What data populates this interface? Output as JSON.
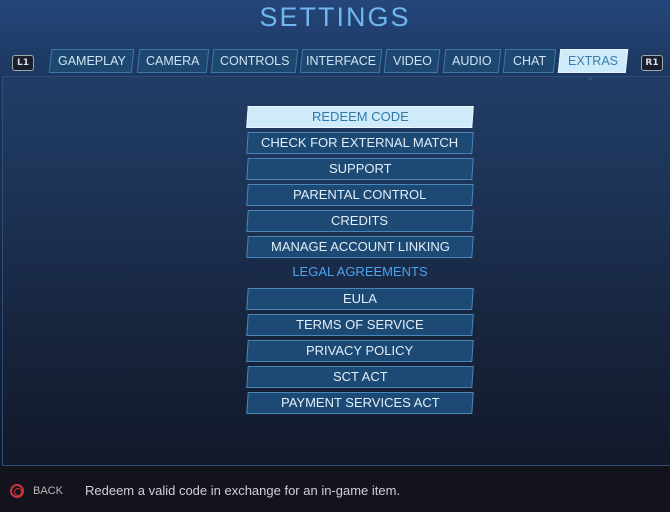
{
  "title": "SETTINGS",
  "left_bumper": "L1",
  "right_bumper": "R1",
  "tabs": [
    "GAMEPLAY",
    "CAMERA",
    "CONTROLS",
    "INTERFACE",
    "VIDEO",
    "AUDIO",
    "CHAT",
    "EXTRAS"
  ],
  "active_tab": "EXTRAS",
  "menu": [
    "REDEEM CODE",
    "CHECK FOR EXTERNAL MATCH",
    "SUPPORT",
    "PARENTAL CONTROL",
    "CREDITS",
    "MANAGE ACCOUNT LINKING"
  ],
  "legal_header": "LEGAL AGREEMENTS",
  "legal": [
    "EULA",
    "TERMS OF SERVICE",
    "PRIVACY POLICY",
    "SCT ACT",
    "PAYMENT SERVICES ACT"
  ],
  "selected_item": "REDEEM CODE",
  "footer": {
    "back_icon": "circle-button-icon",
    "back_label": "BACK",
    "description": "Redeem a valid code in exchange for an in-game item."
  }
}
